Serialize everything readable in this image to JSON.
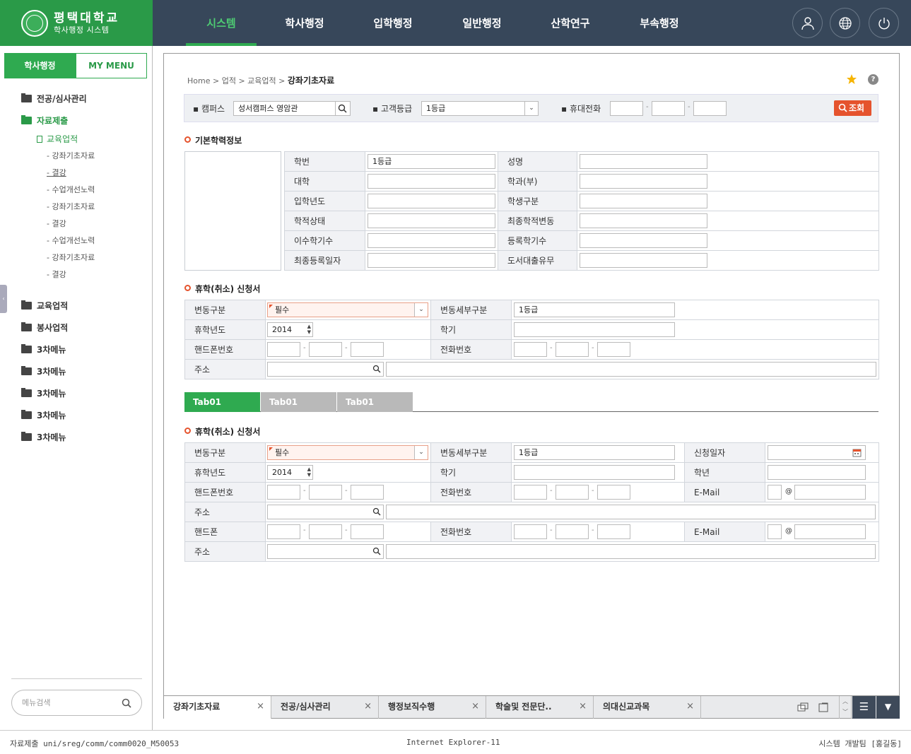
{
  "app": {
    "logo_title": "평택대학교",
    "logo_subtitle": "학사행정 시스템"
  },
  "topnav": [
    "시스템",
    "학사행정",
    "입학행정",
    "일반행정",
    "산학연구",
    "부속행정"
  ],
  "topnav_active": "시스템",
  "header_icons": [
    "user-icon",
    "globe-icon",
    "power-icon"
  ],
  "left_tabs": {
    "active": "학사행정",
    "other": "MY MENU"
  },
  "menu": {
    "m1": "전공/심사관리",
    "m2": "자료제출",
    "m2_sub": "교육업적",
    "m2_items": [
      "강좌기초자료",
      "결강",
      "수업개선노력",
      "강좌기초자료",
      "결강",
      "수업개선노력",
      "강좌기초자료",
      "결강"
    ],
    "m3": "교육업적",
    "m4": "봉사업적",
    "m5": "3차메뉴",
    "m6": "3차메뉴",
    "m7": "3차메뉴",
    "m8": "3차메뉴",
    "m9": "3차메뉴"
  },
  "menu_search_placeholder": "메뉴검색",
  "breadcrumb": {
    "home": "Home",
    "sep": ">",
    "b1": "업적",
    "b2": "교육업적",
    "current": "강좌기초자료"
  },
  "search": {
    "campus_label": "캠퍼스",
    "campus_value": "성서캠퍼스 영암관",
    "grade_label": "고객등급",
    "grade_value": "1등급",
    "phone_label": "휴대전화",
    "button": "조회"
  },
  "basic": {
    "title": "기본학력정보",
    "rows": [
      [
        "학번",
        "1등급",
        "성명",
        ""
      ],
      [
        "대학",
        "",
        "학과(부)",
        ""
      ],
      [
        "입학년도",
        "",
        "학생구분",
        ""
      ],
      [
        "학적상태",
        "",
        "최종학적변동",
        ""
      ],
      [
        "이수학기수",
        "",
        "등록학기수",
        ""
      ],
      [
        "최종등록일자",
        "",
        "도서대출유무",
        ""
      ]
    ]
  },
  "leave1": {
    "title": "휴학(취소) 신청서",
    "type_label": "변동구분",
    "type_value": "필수",
    "detail_label": "변동세부구분",
    "detail_value": "1등급",
    "year_label": "휴학년도",
    "year_value": "2014",
    "sem_label": "학기",
    "hp_label": "핸드폰번호",
    "tel_label": "전화번호",
    "addr_label": "주소"
  },
  "tabs": [
    "Tab01",
    "Tab01",
    "Tab01"
  ],
  "leave2": {
    "title": "휴학(취소) 신청서",
    "type_label": "변동구분",
    "type_value": "필수",
    "detail_label": "변동세부구분",
    "detail_value": "1등급",
    "apply_label": "신청일자",
    "year_label": "휴학년도",
    "year_value": "2014",
    "sem_label": "학기",
    "grade_label": "학년",
    "hp_label": "핸드폰번호",
    "tel_label": "전화번호",
    "email_label": "E-Mail",
    "addr_label": "주소",
    "hp2_label": "핸드폰",
    "tel2_label": "전화번호",
    "email2_label": "E-Mail",
    "addr2_label": "주소",
    "at": "@"
  },
  "bottom_tabs": [
    "강좌기초자료",
    "전공/심사관리",
    "행정보직수행",
    "학술및 전문단..",
    "의대신교과목"
  ],
  "status": {
    "left": "자료제출 uni/sreg/comm/comm0020_M50053",
    "center": "Internet Explorer-11",
    "right": "시스템 개발팀 [홍길동]"
  },
  "colors": {
    "brand_green": "#2a9a48",
    "nav_bg": "#37475a",
    "accent_red": "#e5532d"
  }
}
